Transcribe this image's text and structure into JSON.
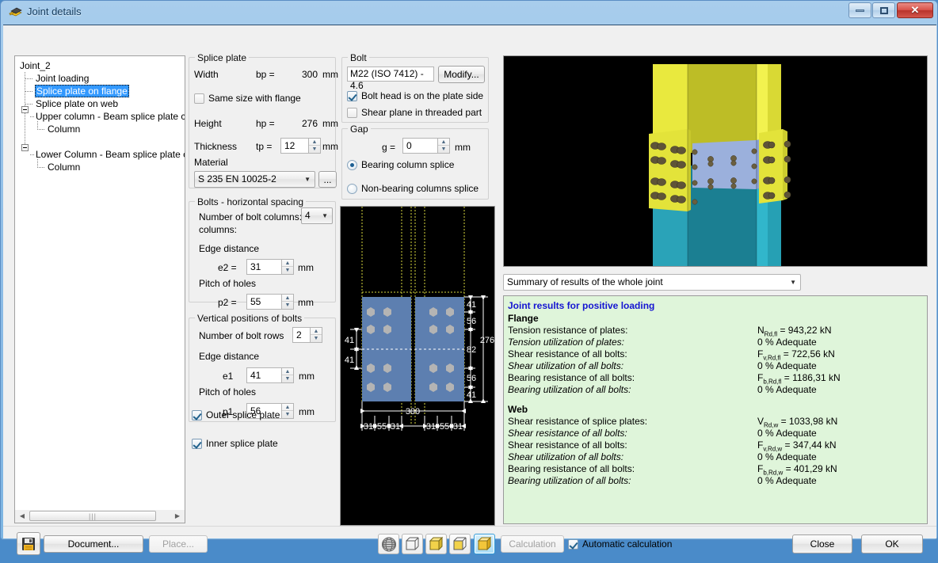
{
  "window": {
    "title": "Joint details",
    "icon": "joint-details-icon",
    "buttons": {
      "minimize": "minimize",
      "maximize": "maximize",
      "close": "close"
    }
  },
  "tree": {
    "root": "Joint_2",
    "items": [
      {
        "label": "Joint loading",
        "level": 1,
        "selected": false,
        "expandable": false
      },
      {
        "label": "Splice plate on flange",
        "level": 1,
        "selected": true,
        "expandable": false
      },
      {
        "label": "Splice plate on web",
        "level": 1,
        "selected": false,
        "expandable": false
      },
      {
        "label": "Upper column - Beam splice plate conn",
        "level": 1,
        "selected": false,
        "expandable": true
      },
      {
        "label": "Column",
        "level": 2,
        "selected": false,
        "expandable": false
      },
      {
        "label": "Lower Column - Beam splice plate con",
        "level": 1,
        "selected": false,
        "expandable": true
      },
      {
        "label": "Column",
        "level": 2,
        "selected": false,
        "expandable": false
      }
    ]
  },
  "splice_plate": {
    "legend": "Splice plate",
    "width_label": "Width",
    "width_symbol": "bp =",
    "width_value": "300",
    "width_unit": "mm",
    "same_size_label": "Same size with flange",
    "same_size_checked": false,
    "height_label": "Height",
    "height_symbol": "hp =",
    "height_value": "276",
    "height_unit": "mm",
    "thickness_label": "Thickness",
    "thickness_symbol": "tp =",
    "thickness_value": "12",
    "thickness_unit": "mm",
    "material_label": "Material",
    "material_value": "S 235 EN 10025-2",
    "material_browse": "..."
  },
  "bolts_horizontal": {
    "legend": "Bolts - horizontal spacing",
    "num_columns_label": "Number of bolt columns:",
    "num_columns_label2": "columns:",
    "num_columns_value": "4",
    "edge_distance_label": "Edge distance",
    "e2_symbol": "e2 =",
    "e2_value": "31",
    "e2_unit": "mm",
    "pitch_label": "Pitch of holes",
    "p2_symbol": "p2 =",
    "p2_value": "55",
    "p2_unit": "mm"
  },
  "bolts_vertical": {
    "legend": "Vertical positions of bolts",
    "num_rows_label": "Number of bolt rows",
    "num_rows_value": "2",
    "edge_distance_label": "Edge distance",
    "e1_symbol": "e1",
    "e1_value": "41",
    "e1_unit": "mm",
    "pitch_label": "Pitch of holes",
    "p1_symbol": "p1",
    "p1_value": "56",
    "p1_unit": "mm"
  },
  "plate_options": {
    "outer_label": "Outer splice plate",
    "outer_checked": true,
    "inner_label": "Inner splice plate",
    "inner_checked": true
  },
  "bolt": {
    "legend": "Bolt",
    "spec": "M22 (ISO 7412) - 4.6",
    "modify_label": "Modify...",
    "head_plate_side_label": "Bolt head is on the plate side",
    "head_plate_side_checked": true,
    "shear_threaded_label": "Shear plane in threaded part",
    "shear_threaded_checked": false
  },
  "gap": {
    "legend": "Gap",
    "g_symbol": "g =",
    "g_value": "0",
    "g_unit": "mm",
    "bearing_label": "Bearing column splice",
    "bearing_selected": true,
    "nonbearing_label": "Non-bearing columns splice",
    "nonbearing_selected": false
  },
  "results": {
    "selector_value": "Summary of results of the whole joint",
    "title": "Joint results for positive loading",
    "sections": [
      {
        "heading": "Flange",
        "rows": [
          {
            "label": "Tension resistance of plates:",
            "italic": false,
            "value": "NRd,fl = 943,22 kN",
            "sym": "N",
            "sub": "Rd,fl",
            "rest": " = 943,22 kN"
          },
          {
            "label": "Tension utilization of plates:",
            "italic": true,
            "value": "0 % Adequate"
          },
          {
            "label": "Shear resistance of all bolts:",
            "italic": false,
            "value": "Fv,Rd,fl = 722,56 kN",
            "sym": "F",
            "sub": "v,Rd,fl",
            "rest": " = 722,56 kN"
          },
          {
            "label": "Shear utilization of all bolts:",
            "italic": true,
            "value": "0 % Adequate"
          },
          {
            "label": "Bearing resistance of all bolts:",
            "italic": false,
            "value": "Fb,Rd,fl = 1186,31 kN",
            "sym": "F",
            "sub": "b,Rd,fl",
            "rest": " = 1186,31 kN"
          },
          {
            "label": "Bearing utilization of all bolts:",
            "italic": true,
            "value": "0 % Adequate"
          }
        ]
      },
      {
        "heading": "Web",
        "rows": [
          {
            "label": "Shear resistance of splice plates:",
            "italic": false,
            "value": "VRd,w = 1033,98 kN",
            "sym": "V",
            "sub": "Rd,w",
            "rest": " = 1033,98 kN"
          },
          {
            "label": "Shear resistance of all bolts:",
            "italic": true,
            "value": "0 % Adequate"
          },
          {
            "label": "Shear resistance of all bolts:",
            "italic": false,
            "value": "Fv,Rd,w = 347,44 kN",
            "sym": "F",
            "sub": "v,Rd,w",
            "rest": " = 347,44 kN"
          },
          {
            "label": "Shear utilization of all bolts:",
            "italic": true,
            "value": "0 % Adequate"
          },
          {
            "label": "Bearing resistance of all bolts:",
            "italic": false,
            "value": "Fb,Rd,w = 401,29 kN",
            "sym": "F",
            "sub": "b,Rd,w",
            "rest": " = 401,29 kN"
          },
          {
            "label": "Bearing utilization of all bolts:",
            "italic": true,
            "value": "0 % Adequate"
          }
        ]
      }
    ]
  },
  "drawing2d": {
    "overall_width": "300",
    "overall_height": "276",
    "vertical_dims": [
      "41",
      "56",
      "82",
      "56",
      "41"
    ],
    "left_dims": [
      "41",
      "41"
    ],
    "horizontal_dims": [
      "31",
      "55",
      "31",
      "31",
      "55",
      "31"
    ]
  },
  "bottom": {
    "save_icon": "save-icon",
    "document_label": "Document...",
    "place_label": "Place...",
    "place_disabled": true,
    "view_icons": [
      "globe-wireframe-icon",
      "cube-wireframe-icon",
      "cube-shaded-icon",
      "cube-hidden-line-icon",
      "cube-solid-icon"
    ],
    "view_selected_index": 4,
    "calculation_label": "Calculation",
    "calculation_disabled": true,
    "auto_calc_label": "Automatic calculation",
    "auto_calc_checked": true,
    "close_label": "Close",
    "ok_label": "OK"
  },
  "colors": {
    "accent": "#3399ff",
    "results_bg": "#dff5da",
    "results_title": "#1414d2",
    "plate_blue": "#5577aa",
    "column_yellow": "#e8e83a",
    "column_teal": "#1f97aa"
  }
}
